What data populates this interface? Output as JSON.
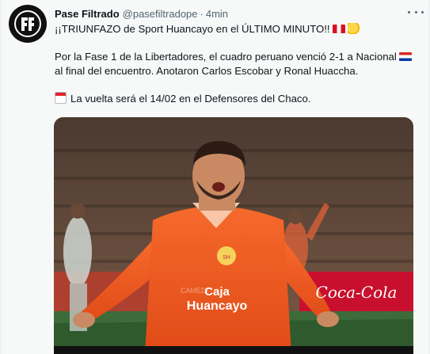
{
  "tweet": {
    "author_name": "Pase Filtrado",
    "handle": "@pasefiltradope",
    "separator": "·",
    "time": "4min",
    "line1": "¡¡TRIUNFAZO de Sport Huancayo en el ÚLTIMO MINUTO!!",
    "line2": "Por la Fase 1 de la Libertadores, el cuadro peruano venció 2-1 a Nacional",
    "line3": "al final del encuentro. Anotaron Carlos Escobar y Ronal Huaccha.",
    "line4": "La vuelta será el 14/02 en el Defensores del Chaco."
  },
  "media": {
    "jersey_line1": "Caja",
    "jersey_line2": "Huancayo",
    "sponsor": "Coca-Cola",
    "board_text": "CAMEDI"
  },
  "icons": {
    "avatar": "pf-logo-icon",
    "more": "more-options-icon",
    "flag_peru": "peru-flag-icon",
    "clap": "clapping-hands-icon",
    "flag_paraguay": "paraguay-flag-icon",
    "calendar": "calendar-icon"
  },
  "colors": {
    "jersey": "#f25a22",
    "avatar_bg": "#111111",
    "text": "#0f1419",
    "muted": "#536471"
  }
}
